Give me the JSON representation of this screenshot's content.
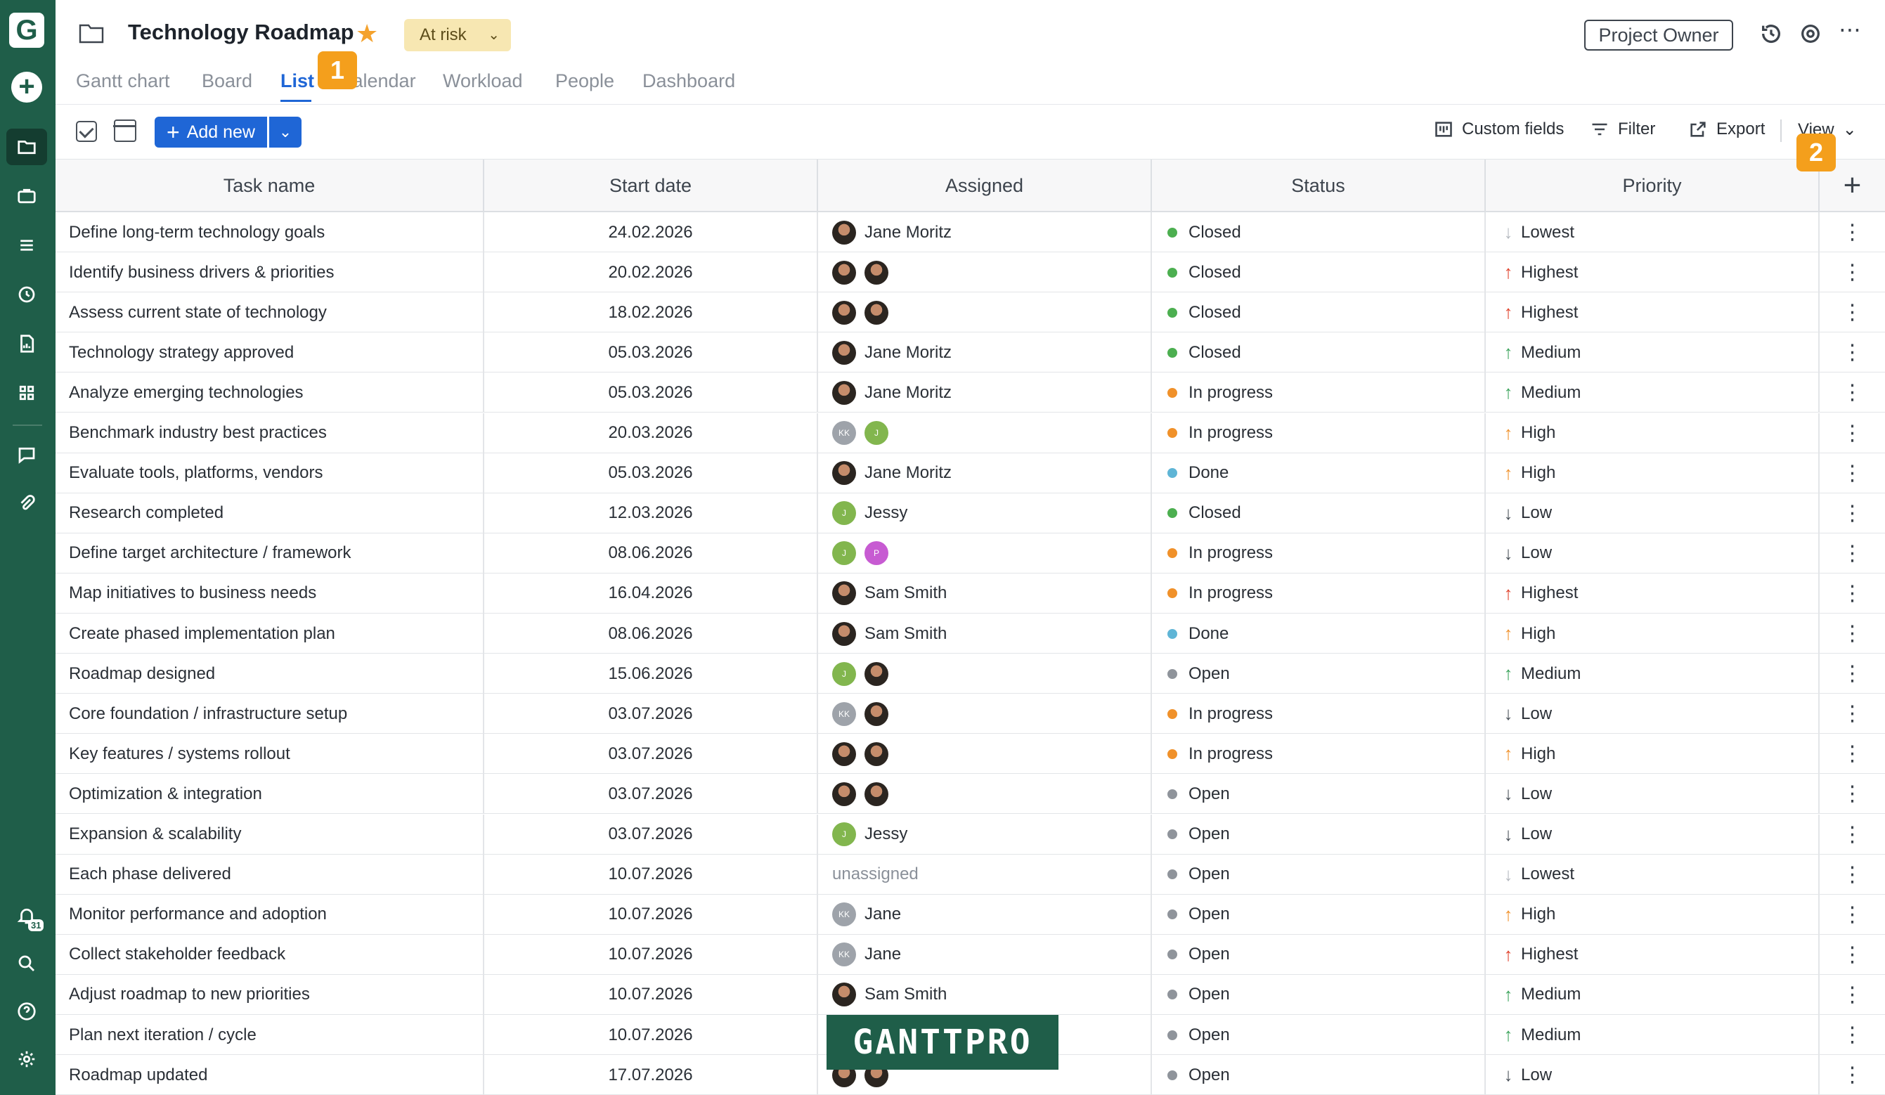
{
  "app": {
    "logo_letter": "G"
  },
  "header": {
    "title": "Technology Roadmap",
    "status": "At risk",
    "owner_button": "Project Owner"
  },
  "tabs": [
    "Gantt chart",
    "Board",
    "List",
    "Calendar",
    "Workload",
    "People",
    "Dashboard"
  ],
  "active_tab": "List",
  "callouts": [
    "1",
    "2"
  ],
  "toolbar": {
    "add_new": "Add new",
    "custom_fields": "Custom fields",
    "filter": "Filter",
    "export": "Export",
    "view": "View"
  },
  "notification_count": "31",
  "columns": [
    "Task name",
    "Start date",
    "Assigned",
    "Status",
    "Priority"
  ],
  "colors": {
    "sidebar": "#1f5e49",
    "accent": "#1f66d6",
    "callout": "#f49f1c",
    "status_closed": "#4caf50",
    "status_in_progress": "#f0912a",
    "status_done": "#5fb5d6",
    "status_open": "#8f949b"
  },
  "rows": [
    {
      "task": "Define long-term technology goals",
      "date": "24.02.2026",
      "avatars": [
        "photo"
      ],
      "assignee": "Jane Moritz",
      "status": "Closed",
      "priority": "Lowest"
    },
    {
      "task": "Identify business drivers & priorities",
      "date": "20.02.2026",
      "avatars": [
        "photo",
        "photo"
      ],
      "assignee": "",
      "status": "Closed",
      "priority": "Highest"
    },
    {
      "task": "Assess current state of technology",
      "date": "18.02.2026",
      "avatars": [
        "photo",
        "photo"
      ],
      "assignee": "",
      "status": "Closed",
      "priority": "Highest"
    },
    {
      "task": "Technology strategy approved",
      "date": "05.03.2026",
      "avatars": [
        "photo"
      ],
      "assignee": "Jane Moritz",
      "status": "Closed",
      "priority": "Medium"
    },
    {
      "task": "Analyze emerging technologies",
      "date": "05.03.2026",
      "avatars": [
        "photo"
      ],
      "assignee": "Jane Moritz",
      "status": "In progress",
      "priority": "Medium"
    },
    {
      "task": "Benchmark industry best practices",
      "date": "20.03.2026",
      "avatars": [
        "KK",
        "J"
      ],
      "assignee": "",
      "status": "In progress",
      "priority": "High"
    },
    {
      "task": "Evaluate tools, platforms, vendors",
      "date": "05.03.2026",
      "avatars": [
        "photo"
      ],
      "assignee": "Jane Moritz",
      "status": "Done",
      "priority": "High"
    },
    {
      "task": "Research completed",
      "date": "12.03.2026",
      "avatars": [
        "J"
      ],
      "assignee": "Jessy",
      "status": "Closed",
      "priority": "Low"
    },
    {
      "task": "Define target architecture / framework",
      "date": "08.06.2026",
      "avatars": [
        "J",
        "P"
      ],
      "assignee": "",
      "status": "In progress",
      "priority": "Low"
    },
    {
      "task": "Map initiatives to business needs",
      "date": "16.04.2026",
      "avatars": [
        "photo"
      ],
      "assignee": "Sam Smith",
      "status": "In progress",
      "priority": "Highest"
    },
    {
      "task": "Create phased implementation plan",
      "date": "08.06.2026",
      "avatars": [
        "photo"
      ],
      "assignee": "Sam Smith",
      "status": "Done",
      "priority": "High"
    },
    {
      "task": "Roadmap designed",
      "date": "15.06.2026",
      "avatars": [
        "J",
        "photo"
      ],
      "assignee": "",
      "status": "Open",
      "priority": "Medium"
    },
    {
      "task": "Core foundation / infrastructure setup",
      "date": "03.07.2026",
      "avatars": [
        "KK",
        "photo"
      ],
      "assignee": "",
      "status": "In progress",
      "priority": "Low"
    },
    {
      "task": "Key features / systems rollout",
      "date": "03.07.2026",
      "avatars": [
        "photo",
        "photo"
      ],
      "assignee": "",
      "status": "In progress",
      "priority": "High"
    },
    {
      "task": "Optimization & integration",
      "date": "03.07.2026",
      "avatars": [
        "photo",
        "photo"
      ],
      "assignee": "",
      "status": "Open",
      "priority": "Low"
    },
    {
      "task": "Expansion & scalability",
      "date": "03.07.2026",
      "avatars": [
        "J"
      ],
      "assignee": "Jessy",
      "status": "Open",
      "priority": "Low"
    },
    {
      "task": "Each phase delivered",
      "date": "10.07.2026",
      "avatars": [],
      "assignee": "unassigned",
      "status": "Open",
      "priority": "Lowest"
    },
    {
      "task": "Monitor performance and adoption",
      "date": "10.07.2026",
      "avatars": [
        "KK"
      ],
      "assignee": "Jane",
      "status": "Open",
      "priority": "High"
    },
    {
      "task": "Collect stakeholder feedback",
      "date": "10.07.2026",
      "avatars": [
        "KK"
      ],
      "assignee": "Jane",
      "status": "Open",
      "priority": "Highest"
    },
    {
      "task": "Adjust roadmap to new priorities",
      "date": "10.07.2026",
      "avatars": [
        "photo"
      ],
      "assignee": "Sam Smith",
      "status": "Open",
      "priority": "Medium"
    },
    {
      "task": "Plan next iteration / cycle",
      "date": "10.07.2026",
      "avatars": [],
      "assignee": "",
      "status": "Open",
      "priority": "Medium"
    },
    {
      "task": "Roadmap updated",
      "date": "17.07.2026",
      "avatars": [
        "photo",
        "photo"
      ],
      "assignee": "",
      "status": "Open",
      "priority": "Low"
    }
  ],
  "watermark": "GANTTPRO"
}
